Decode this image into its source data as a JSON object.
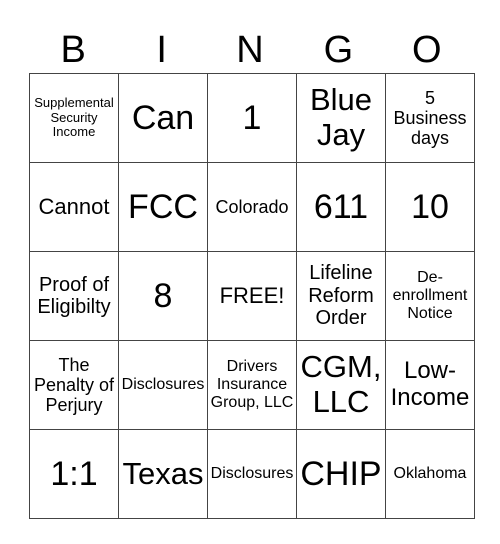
{
  "header": [
    "B",
    "I",
    "N",
    "G",
    "O"
  ],
  "rows": [
    [
      "Supplemental Security Income",
      "Can",
      "1",
      "Blue Jay",
      "5 Business days"
    ],
    [
      "Cannot",
      "FCC",
      "Colorado",
      "611",
      "10"
    ],
    [
      "Proof of Eligibilty",
      "8",
      "FREE!",
      "Lifeline Reform Order",
      "De-enrollment Notice"
    ],
    [
      "The Penalty of Perjury",
      "Disclosures",
      "Drivers Insurance Group, LLC",
      "CGM, LLC",
      "Low-Income"
    ],
    [
      "1:1",
      "Texas",
      "Disclosures",
      "CHIP",
      "Oklahoma"
    ]
  ]
}
